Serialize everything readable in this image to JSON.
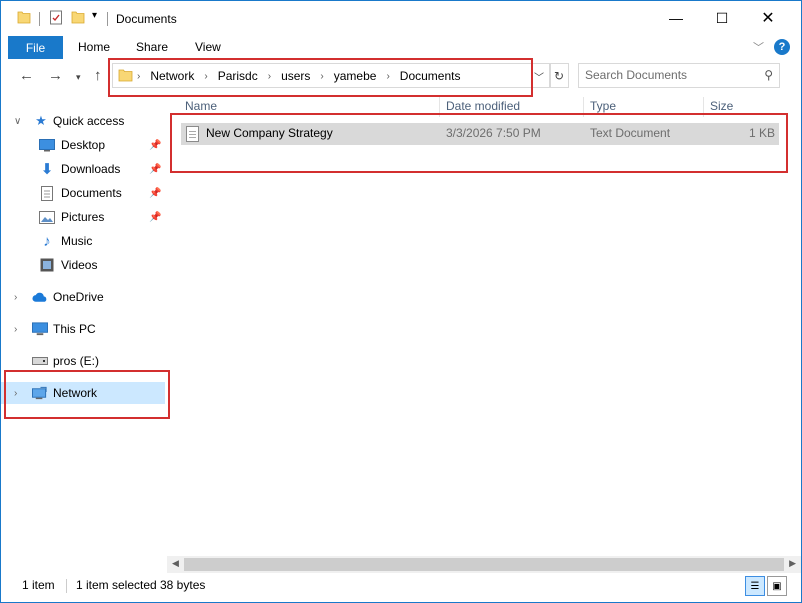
{
  "window": {
    "title": "Documents"
  },
  "ribbon": {
    "tabs": [
      "File",
      "Home",
      "Share",
      "View"
    ]
  },
  "address": {
    "crumbs": [
      "Network",
      "Parisdc",
      "users",
      "yamebe",
      "Documents"
    ]
  },
  "search": {
    "placeholder": "Search Documents"
  },
  "navpane": {
    "items": [
      {
        "label": "Quick access",
        "icon": "star-icon"
      },
      {
        "label": "Desktop",
        "icon": "desktop-icon"
      },
      {
        "label": "Downloads",
        "icon": "download-icon"
      },
      {
        "label": "Documents",
        "icon": "documents-icon"
      },
      {
        "label": "Pictures",
        "icon": "pictures-icon"
      },
      {
        "label": "Music",
        "icon": "music-icon"
      },
      {
        "label": "Videos",
        "icon": "videos-icon"
      },
      {
        "label": "OneDrive",
        "icon": "cloud-icon"
      },
      {
        "label": "This PC",
        "icon": "computer-icon"
      },
      {
        "label": "pros (E:)",
        "icon": "drive-icon"
      },
      {
        "label": "Network",
        "icon": "network-icon"
      }
    ]
  },
  "columns": {
    "name": "Name",
    "date": "Date modified",
    "type": "Type",
    "size": "Size"
  },
  "files": [
    {
      "name": "New Company Strategy",
      "date": "3/3/2026 7:50 PM",
      "type": "Text Document",
      "size": "1 KB"
    }
  ],
  "status": {
    "count": "1 item",
    "selected": "1 item selected",
    "bytes": "38 bytes"
  },
  "colors": {
    "accent": "#1979ca",
    "highlight_box": "#d32f2f",
    "selection": "#cce8ff"
  }
}
